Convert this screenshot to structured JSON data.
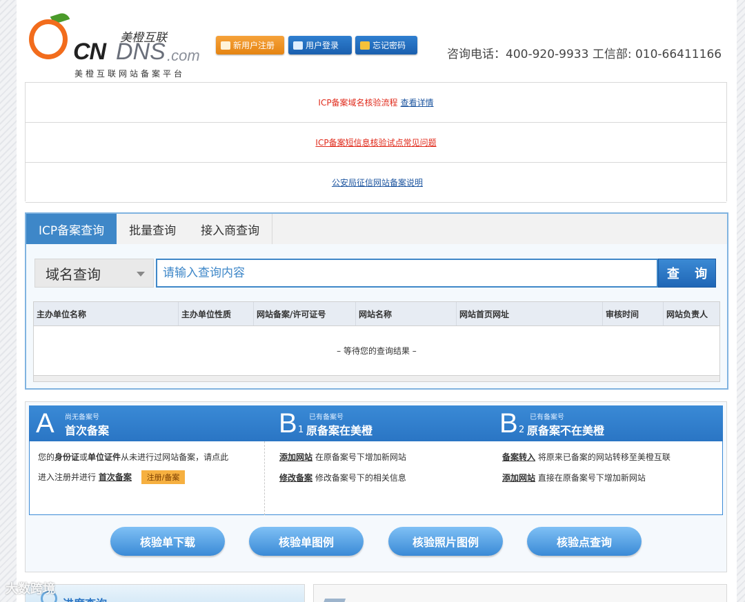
{
  "header": {
    "logo_brand": "CNDNS.com",
    "logo_cn_name": "美橙互联",
    "logo_subtitle": "美橙互联网站备案平台",
    "register_label": "新用户注册",
    "login_label": "用户登录",
    "forgot_label": "忘记密码",
    "hotline": "咨询电话：400-920-9933 工信部: 010-66411166"
  },
  "notices": [
    {
      "text": "ICP备案域名核验流程",
      "link": "查看详情"
    },
    {
      "link": "ICP备案短信息核验试点常见问题"
    },
    {
      "link": "公安局征信网站备案说明"
    }
  ],
  "search": {
    "tabs": [
      "ICP备案查询",
      "批量查询",
      "接入商查询"
    ],
    "select_value": "域名查询",
    "input_placeholder": "请输入查询内容",
    "button_label": "查 询",
    "columns": [
      "主办单位名称",
      "主办单位性质",
      "网站备案/许可证号",
      "网站名称",
      "网站首页网址",
      "审核时间",
      "网站负责人"
    ],
    "waiting_text": "– 等待您的查询结果 –"
  },
  "filing": {
    "col_a": {
      "letter": "A",
      "sub": "尚无备案号",
      "title": "首次备案",
      "line1_pre": "您的",
      "line1_b1": "身份证",
      "line1_mid": "或",
      "line1_b2": "单位证件",
      "line1_post": "从未进行过网站备案，请点此",
      "line2_pre": "进入注册并进行",
      "line2_link": "首次备案",
      "badge": "注册/备案"
    },
    "col_b1": {
      "letter": "B",
      "num": "1",
      "sub": "已有备案号",
      "title": "原备案在美橙",
      "link1": "添加网站",
      "desc1": "在原备案号下增加新网站",
      "link2": "修改备案",
      "desc2": "修改备案号下的相关信息"
    },
    "col_b2": {
      "letter": "B",
      "num": "2",
      "sub": "已有备案号",
      "title": "原备案不在美橙",
      "link1": "备案转入",
      "desc1": "将原来已备案的网站转移至美橙互联",
      "link2": "添加网站",
      "desc2": "直接在原备案号下增加新网站"
    },
    "buttons": [
      "核验单下载",
      "核验单图例",
      "核验照片图例",
      "核验点查询"
    ]
  },
  "bottom": {
    "progress_title": "进度查询",
    "watermark": "大数跨境"
  }
}
